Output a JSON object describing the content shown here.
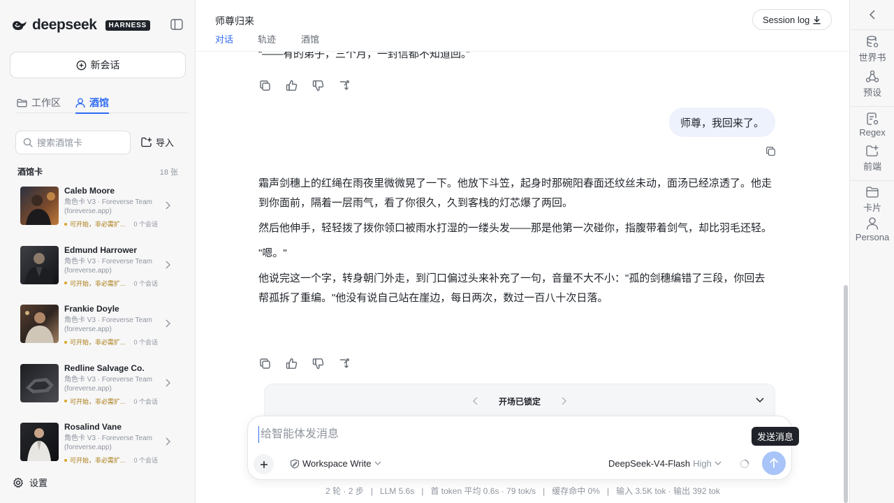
{
  "brand": {
    "name": "deepseek",
    "badge": "HARNESS"
  },
  "sidebar": {
    "new_chat": "新会话",
    "tabs": [
      {
        "label": "工作区",
        "icon": "folder-icon",
        "active": false
      },
      {
        "label": "酒馆",
        "icon": "user-icon",
        "active": true
      }
    ],
    "search_placeholder": "搜索酒馆卡",
    "import_label": "导入",
    "cards_title": "酒馆卡",
    "cards_count": "18 张",
    "cards": [
      {
        "name": "Caleb Moore",
        "meta": "角色卡 V3 · Foreverse Team (foreverse.app)",
        "status": "可开始，非必需扩...",
        "sessions": "0 个会话"
      },
      {
        "name": "Edmund Harrower",
        "meta": "角色卡 V3 · Foreverse Team (foreverse.app)",
        "status": "可开始，非必需扩...",
        "sessions": "0 个会话"
      },
      {
        "name": "Frankie Doyle",
        "meta": "角色卡 V3 · Foreverse Team (foreverse.app)",
        "status": "可开始，非必需扩...",
        "sessions": "0 个会话"
      },
      {
        "name": "Redline Salvage Co.",
        "meta": "角色卡 V3 · Foreverse Team (foreverse.app)",
        "status": "可开始，非必需扩...",
        "sessions": "0 个会话"
      },
      {
        "name": "Rosalind Vane",
        "meta": "角色卡 V3 · Foreverse Team (foreverse.app)",
        "status": "可开始，非必需扩...",
        "sessions": "0 个会话"
      }
    ],
    "settings_label": "设置"
  },
  "main": {
    "title": "师尊归来",
    "tabs": [
      {
        "label": "对话",
        "active": true
      },
      {
        "label": "轨迹",
        "active": false
      },
      {
        "label": "酒馆",
        "active": false
      }
    ],
    "session_log": "Session log",
    "prev_message_tail": "“——有的弟子，三个月，一封信都不知道回。”",
    "user_message": "师尊，我回来了。",
    "assistant_paragraphs": [
      "霜声剑穗上的红绳在雨夜里微微晃了一下。他放下斗笠，起身时那碗阳春面还纹丝未动，面汤已经凉透了。他走到你面前，隔着一层雨气，看了你很久，久到客栈的灯芯爆了两回。",
      "然后他伸手，轻轻拨了拨你领口被雨水打湿的一缕头发——那是他第一次碰你，指腹带着剑气，却比羽毛还轻。",
      "\"嗯。\"",
      "他说完这一个字，转身朝门外走，到门口偏过头来补充了一句，音量不大不小：\"孤的剑穗编错了三段，你回去帮孤拆了重编。\"他没有说自己站在崖边，每日两次，数过一百八十次日落。"
    ],
    "opening_locked": "开场已锁定",
    "composer": {
      "placeholder": "给智能体发消息",
      "mode": "Workspace Write",
      "model": "DeepSeek-V4-Flash",
      "effort": "High",
      "send_tooltip": "发送消息"
    },
    "stats": [
      "2 轮 · 2 步",
      "LLM 5.6s",
      "首 token 平均 0.6s · 79 tok/s",
      "缓存命中 0%",
      "输入 3.5K tok · 输出 392 tok"
    ]
  },
  "rail": {
    "items": [
      {
        "label": "世界书",
        "icon": "database-icon"
      },
      {
        "label": "预设",
        "icon": "preset-icon"
      },
      {
        "label": "Regex",
        "icon": "regex-icon"
      },
      {
        "label": "前端",
        "icon": "frontend-icon"
      },
      {
        "label": "卡片",
        "icon": "folder-icon"
      },
      {
        "label": "Persona",
        "icon": "person-icon"
      }
    ]
  },
  "colors": {
    "accent": "#2f6bf0",
    "send_disabled": "#a8c4f8",
    "user_bubble": "#eef2fd",
    "status_dot": "#d9a52a"
  }
}
